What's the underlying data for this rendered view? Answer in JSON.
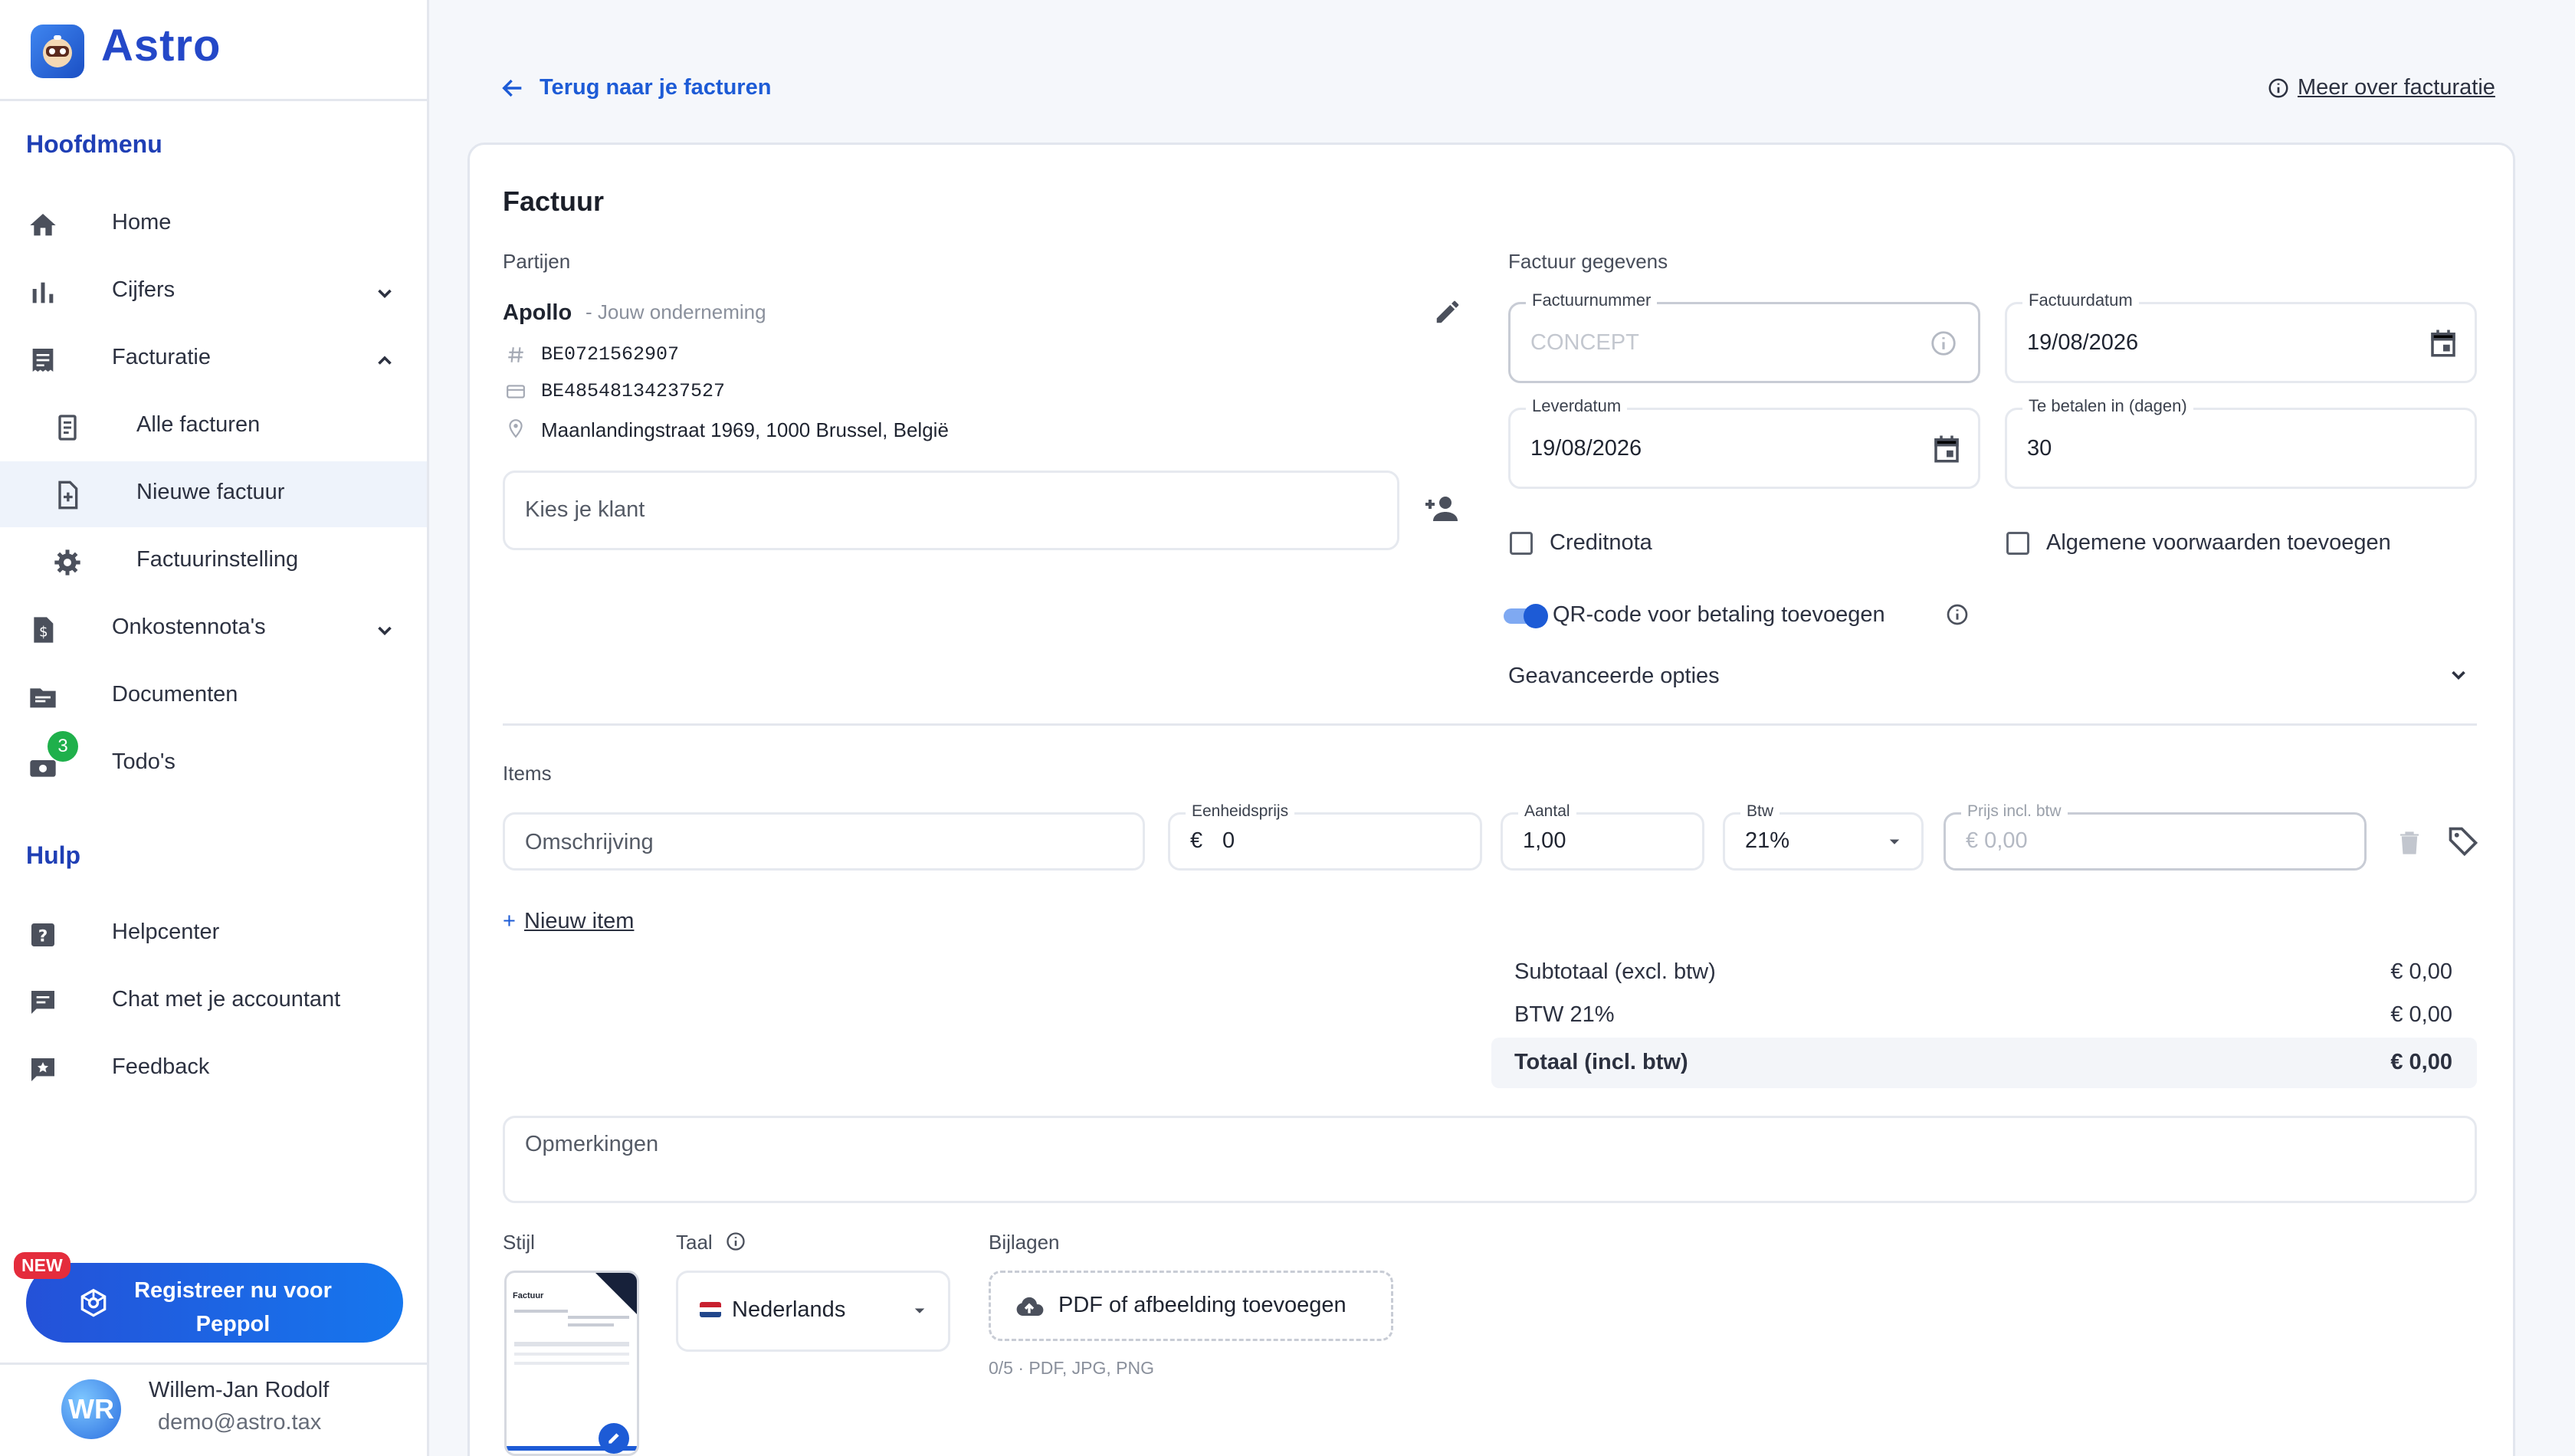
{
  "app": {
    "name": "Astro"
  },
  "sidebar": {
    "main_section": "Hoofdmenu",
    "help_section": "Hulp",
    "items": [
      {
        "label": "Home",
        "icon": "home-icon"
      },
      {
        "label": "Cijfers",
        "icon": "bar-chart-icon"
      },
      {
        "label": "Facturatie",
        "icon": "invoice-icon"
      },
      {
        "label": "Alle facturen",
        "icon": "receipt-icon"
      },
      {
        "label": "Nieuwe factuur",
        "icon": "file-plus-icon"
      },
      {
        "label": "Factuurinstelling",
        "icon": "gear-icon"
      },
      {
        "label": "Onkostennota's",
        "icon": "expense-icon"
      },
      {
        "label": "Documenten",
        "icon": "folder-icon"
      },
      {
        "label": "Todo's",
        "icon": "todo-icon"
      }
    ],
    "todo_badge": "3",
    "help_items": [
      {
        "label": "Helpcenter",
        "icon": "help-icon"
      },
      {
        "label": "Chat met je accountant",
        "icon": "chat-icon"
      },
      {
        "label": "Feedback",
        "icon": "feedback-icon"
      }
    ],
    "peppol_button": "Registreer nu voor Peppol",
    "new_badge": "NEW",
    "user": {
      "initials": "WR",
      "name": "Willem-Jan Rodolf",
      "email": "demo@astro.tax"
    }
  },
  "topbar": {
    "back_link": "Terug naar je facturen",
    "info_link": "Meer over facturatie"
  },
  "invoice": {
    "title": "Factuur",
    "parties_label": "Partijen",
    "company": {
      "name": "Apollo",
      "tag": "- Jouw onderneming",
      "vat": "BE0721562907",
      "iban": "BE48548134237527",
      "address": "Maanlandingstraat 1969, 1000 Brussel, België"
    },
    "client_placeholder": "Kies je klant",
    "details_label": "Factuur gegevens",
    "number": {
      "label": "Factuurnummer",
      "placeholder": "CONCEPT"
    },
    "date": {
      "label": "Factuurdatum",
      "value": "19/08/2026"
    },
    "delivery": {
      "label": "Leverdatum",
      "value": "19/08/2026"
    },
    "due": {
      "label": "Te betalen in (dagen)",
      "value": "30"
    },
    "creditnota": "Creditnota",
    "terms": "Algemene voorwaarden toevoegen",
    "qr": "QR-code voor betaling toevoegen",
    "advanced": "Geavanceerde opties",
    "items_label": "Items",
    "item": {
      "desc_placeholder": "Omschrijving",
      "unit_label": "Eenheidsprijs",
      "currency": "€",
      "unit_value": "0",
      "qty_label": "Aantal",
      "qty_value": "1,00",
      "vat_label": "Btw",
      "vat_value": "21%",
      "price_label": "Prijs incl. btw",
      "price_placeholder": "€ 0,00"
    },
    "new_item": "Nieuw item",
    "new_item_plus": "+",
    "totals": {
      "subtotal_label": "Subtotaal (excl. btw)",
      "subtotal": "€ 0,00",
      "vat_label": "BTW 21%",
      "vat": "€ 0,00",
      "total_label": "Totaal (incl. btw)",
      "total": "€ 0,00"
    },
    "remarks_placeholder": "Opmerkingen",
    "style_label": "Stijl",
    "language_label": "Taal",
    "language_value": "Nederlands",
    "attachments_label": "Bijlagen",
    "attach_button": "PDF of afbeelding toevoegen",
    "attach_hint": "0/5 · PDF, JPG, PNG",
    "thumb_title": "Factuur"
  },
  "colors": {
    "accent": "#1d5bd6",
    "brand": "#2448c8",
    "badge_green": "#1fb04b",
    "new_red": "#e42c3c"
  }
}
